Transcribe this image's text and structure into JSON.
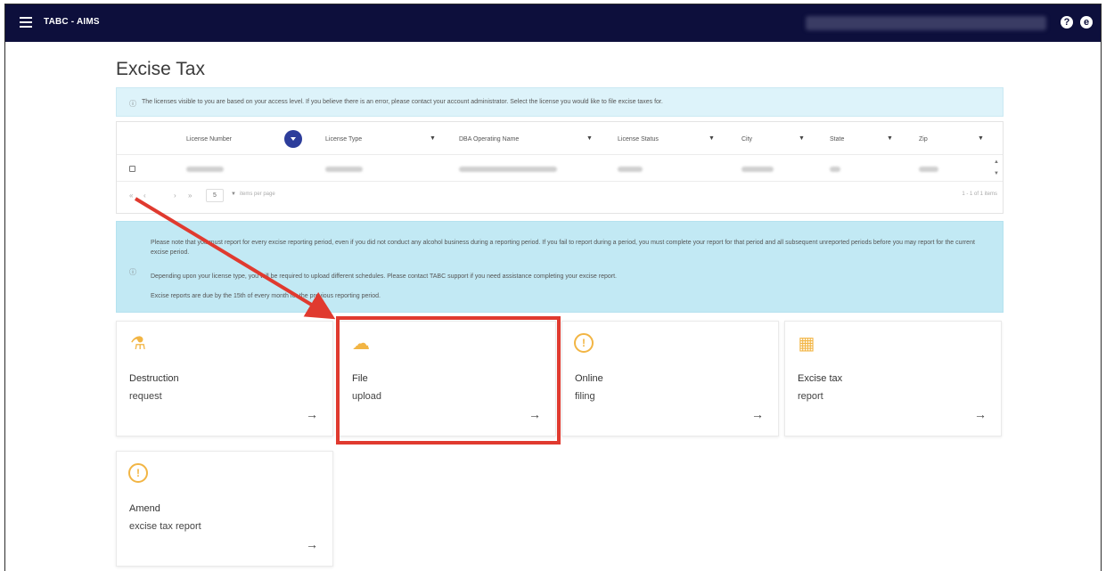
{
  "header": {
    "app_title": "TABC - AIMS",
    "menu_icon": "hamburger-icon",
    "help_icon": "?",
    "account_icon": "e"
  },
  "page": {
    "title": "Excise Tax"
  },
  "info": {
    "icon": "ⓘ",
    "text": "The licenses visible to you are based on your access level. If you believe there is an error, please contact your account administrator. Select the license you would like to file excise taxes for."
  },
  "grid": {
    "columns": [
      "License Number",
      "License Type",
      "DBA Operating Name",
      "License Status",
      "City",
      "State",
      "Zip"
    ],
    "filter_symbol": "▼",
    "pager": {
      "first": "«",
      "prev": "‹",
      "next": "›",
      "last": "»",
      "page_size": "5",
      "page_size_arrow": "▼",
      "items_per_page": "items per page",
      "count": "1 - 1 of 1 items"
    }
  },
  "notice": {
    "icon": "ⓘ",
    "para1": "Please note that you must report for every excise reporting period, even if you did not conduct any alcohol business during a reporting period. If you fail to report during a period, you must complete your report for that period and all subsequent unreported periods before you may report for the current excise period.",
    "para2": "Depending upon your license type, you will be required to upload different schedules. Please contact TABC support if you need assistance completing your excise report.",
    "para3": "Excise reports are due by the 15th of every month for the previous reporting period."
  },
  "cards": [
    {
      "line1": "Destruction",
      "line2": "request",
      "icon": "destruction-icon",
      "glyph": "⚗",
      "arrow": "→"
    },
    {
      "line1": "File",
      "line2": "upload",
      "icon": "file-upload-icon",
      "glyph": "☁",
      "arrow": "→"
    },
    {
      "line1": "Online",
      "line2": "filing",
      "icon": "online-filing-icon",
      "glyph": "!",
      "arrow": "→"
    },
    {
      "line1": "Excise tax",
      "line2": "report",
      "icon": "excise-report-icon",
      "glyph": "▦",
      "arrow": "→"
    },
    {
      "line1": "Amend",
      "line2": "excise tax report",
      "icon": "amend-icon",
      "glyph": "!",
      "arrow": "→"
    }
  ],
  "colors": {
    "topbar": "#0d0f3c",
    "accent": "#2d3d9b",
    "highlight": "#e03a2f",
    "icon": "#f2b544",
    "info_bg": "#ddf3fa",
    "notice_bg": "#c2e9f4"
  }
}
